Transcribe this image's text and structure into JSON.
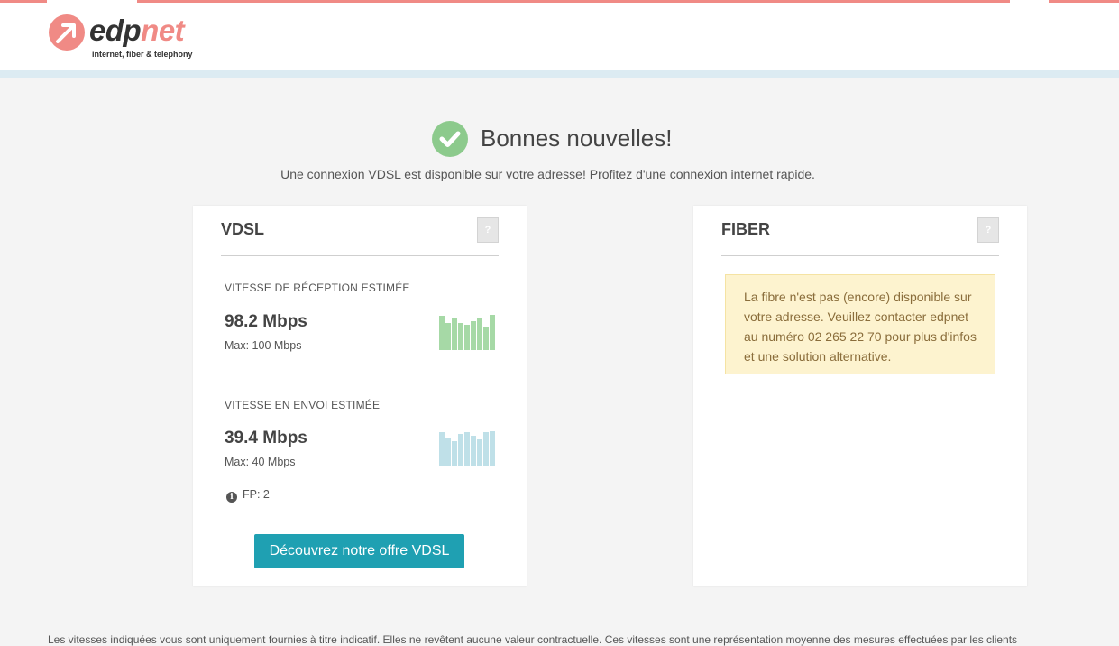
{
  "header": {
    "logo_prefix": "edp",
    "logo_suffix": "net",
    "tagline": "internet, fiber & telephony"
  },
  "hero": {
    "title": "Bonnes nouvelles!",
    "subtitle": "Une connexion VDSL est disponible sur votre adresse! Profitez d'une connexion internet rapide."
  },
  "vdsl": {
    "title": "VDSL",
    "help": "?",
    "download": {
      "label": "VITESSE DE RÉCEPTION ESTIMÉE",
      "value": "98.2 Mbps",
      "max": "Max: 100 Mbps",
      "bar_levels": [
        0.95,
        0.75,
        0.9,
        0.75,
        0.7,
        0.8,
        0.9,
        0.65,
        0.97
      ],
      "color": "#a6d9a6"
    },
    "upload": {
      "label": "VITESSE EN ENVOI ESTIMÉE",
      "value": "39.4 Mbps",
      "max": "Max: 40 Mbps",
      "bar_levels": [
        0.95,
        0.8,
        0.7,
        0.9,
        0.95,
        0.85,
        0.75,
        0.95,
        0.97
      ],
      "color": "#bfe0e8"
    },
    "fp": "FP: 2",
    "cta": "Découvrez notre offre VDSL"
  },
  "fiber": {
    "title": "FIBER",
    "help": "?",
    "notice": "La fibre n'est pas (encore) disponible sur votre adresse. Veuillez contacter edpnet au numéro 02 265 22 70 pour plus d'infos et une solution alternative."
  },
  "footer": {
    "disclaimer": "Les vitesses indiquées vous sont uniquement fournies à titre indicatif. Elles ne revêtent aucune valeur contractuelle. Ces vitesses sont une représentation moyenne des mesures effectuées par les clients"
  },
  "colors": {
    "brand": "#f08a85",
    "success": "#8cca8c",
    "cta": "#1fa0b2"
  }
}
